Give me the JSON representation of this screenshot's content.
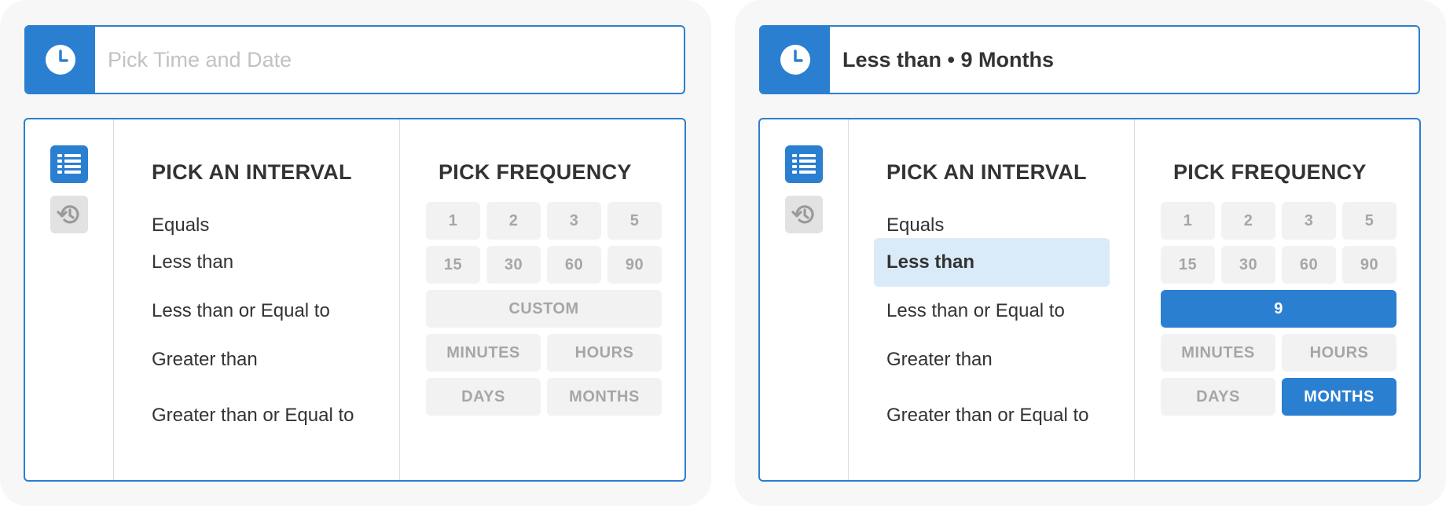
{
  "colors": {
    "accent": "#2b7fd0",
    "selected_row": "#d9ebf8",
    "button_bg": "#f2f2f2",
    "button_text": "#a6a6a6"
  },
  "panels": [
    {
      "input": {
        "icon": "clock-icon",
        "placeholder": "Pick Time and Date",
        "value": ""
      },
      "tabs": [
        {
          "icon": "list-icon",
          "active": true
        },
        {
          "icon": "history-icon",
          "active": false
        }
      ],
      "interval": {
        "title": "PICK AN INTERVAL",
        "options": [
          "Equals",
          "Less than",
          "Less than or Equal to",
          "Greater than",
          "Greater than or Equal to"
        ],
        "selected": null
      },
      "frequency": {
        "title": "PICK FREQUENCY",
        "values": [
          "1",
          "2",
          "3",
          "5",
          "15",
          "30",
          "60",
          "90"
        ],
        "custom": "CUSTOM",
        "units": [
          "MINUTES",
          "HOURS",
          "DAYS",
          "MONTHS"
        ],
        "selected_unit": null
      }
    },
    {
      "input": {
        "icon": "clock-icon",
        "placeholder": "",
        "value": "Less than • 9 Months"
      },
      "tabs": [
        {
          "icon": "list-icon",
          "active": true
        },
        {
          "icon": "history-icon",
          "active": false
        }
      ],
      "interval": {
        "title": "PICK AN INTERVAL",
        "options": [
          "Equals",
          "Less than",
          "Less than or Equal to",
          "Greater than",
          "Greater than or Equal to"
        ],
        "selected": "Less than"
      },
      "frequency": {
        "title": "PICK FREQUENCY",
        "values": [
          "1",
          "2",
          "3",
          "5",
          "15",
          "30",
          "60",
          "90"
        ],
        "custom": "9",
        "custom_selected": true,
        "units": [
          "MINUTES",
          "HOURS",
          "DAYS",
          "MONTHS"
        ],
        "selected_unit": "MONTHS"
      }
    }
  ]
}
